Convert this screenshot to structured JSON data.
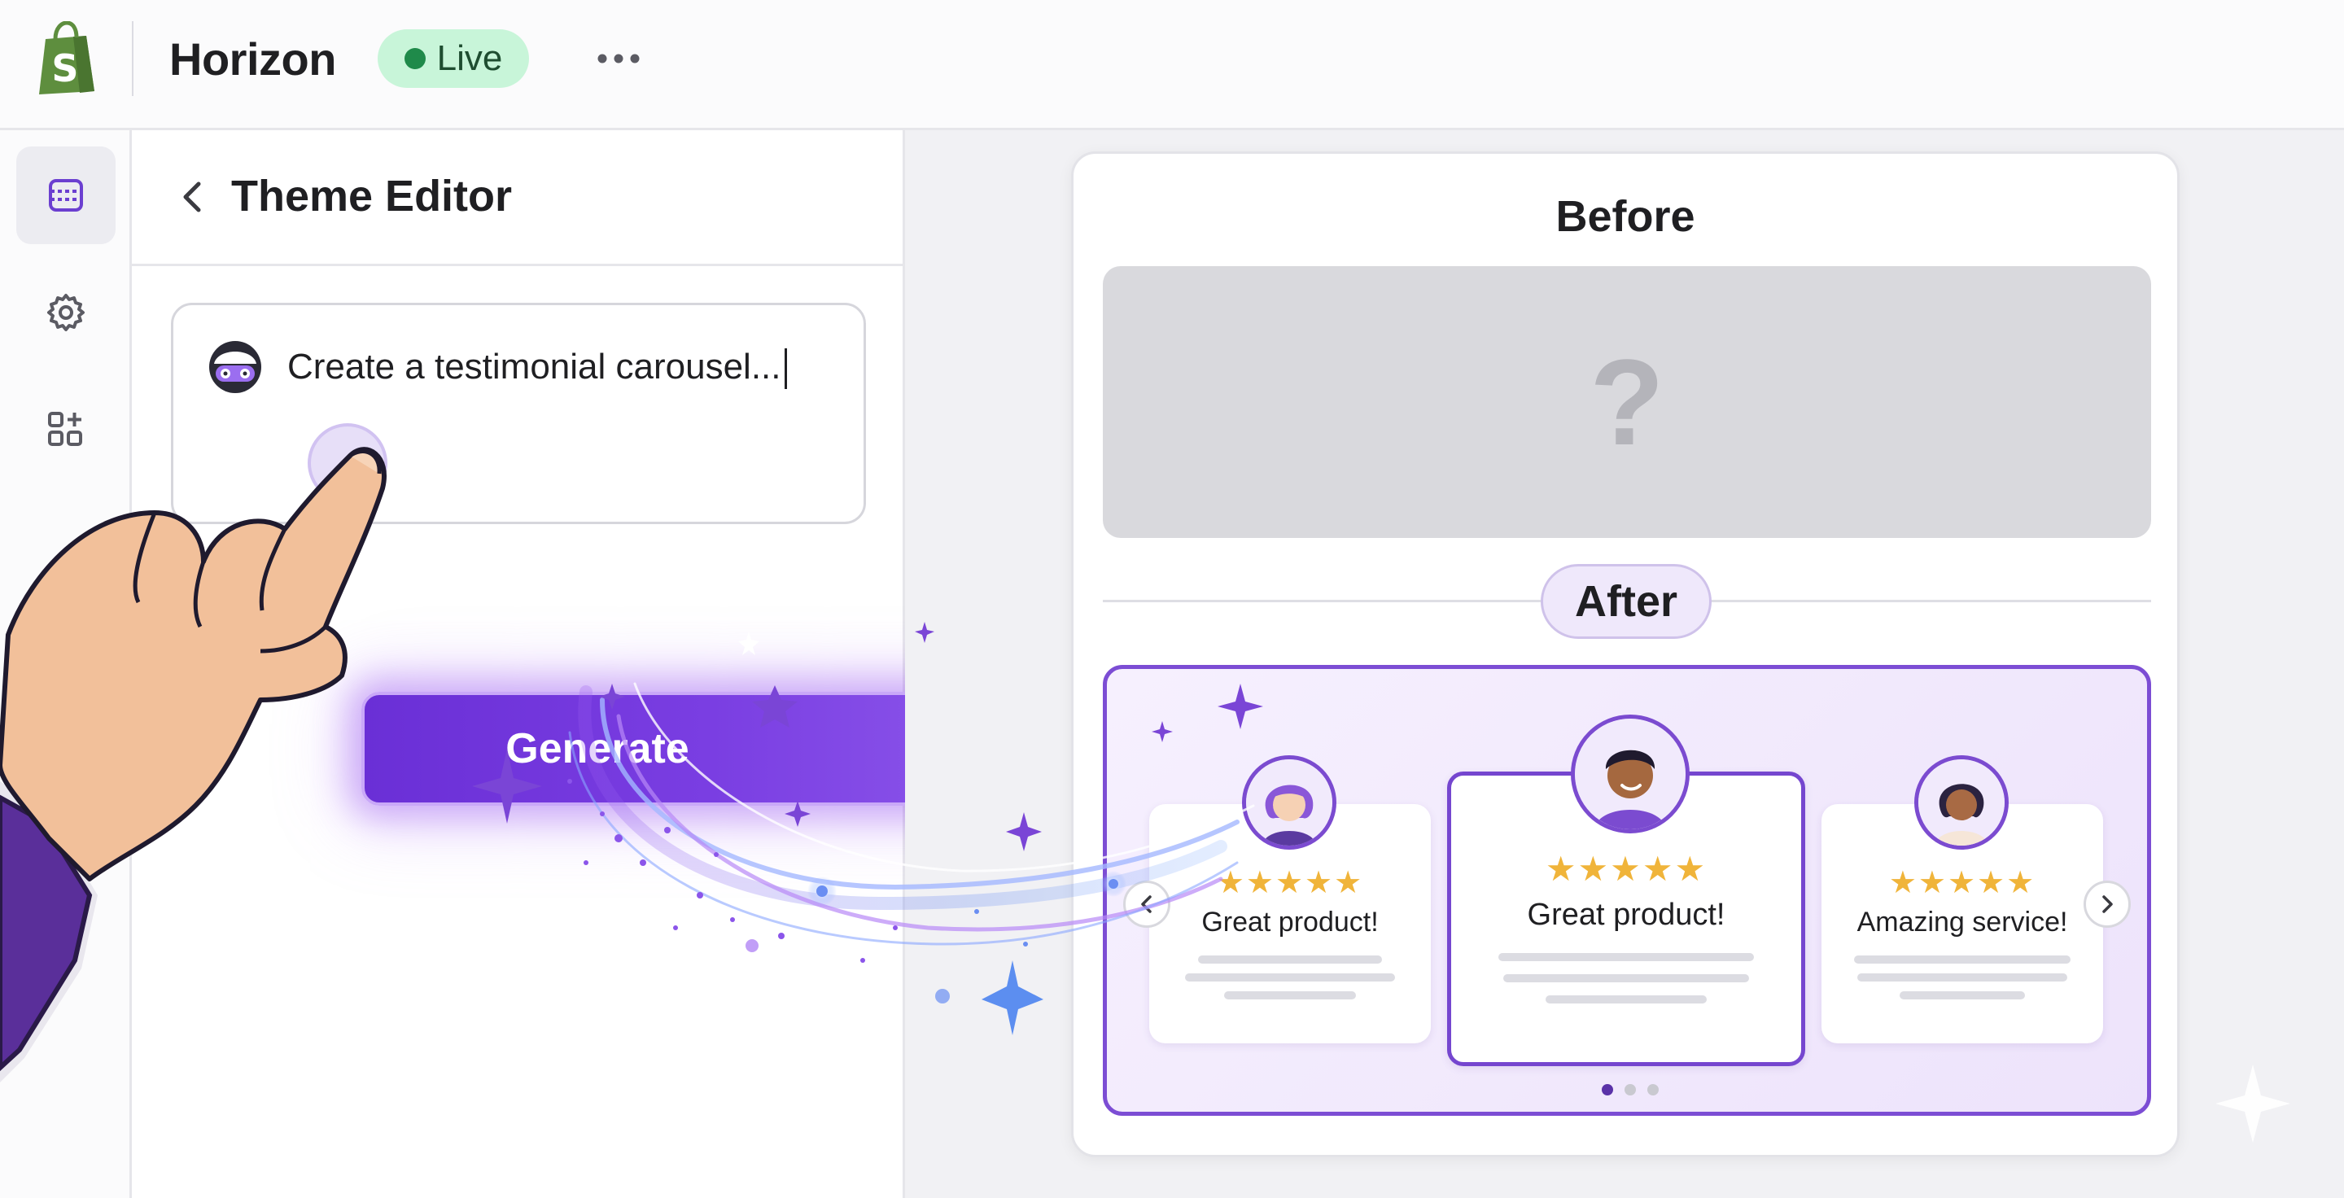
{
  "topbar": {
    "store_name": "Horizon",
    "status_label": "Live",
    "icons": [
      "shopify-logo-icon",
      "more-icon"
    ]
  },
  "rail": {
    "icons": [
      "sections-icon",
      "settings-icon",
      "apps-icon"
    ]
  },
  "editor": {
    "title": "Theme Editor",
    "prompt_value": "Create a testimonial carousel...",
    "generate_label": "Generate"
  },
  "preview": {
    "before_label": "Before",
    "placeholder_mark": "?",
    "after_label": "After",
    "testimonials": [
      {
        "stars": "★★★★★",
        "rating": 5,
        "quote": "Great product!"
      },
      {
        "stars": "★★★★★",
        "rating": 4.5,
        "quote": "Great product!"
      },
      {
        "stars": "★★★★★",
        "rating": 4.5,
        "quote": "Amazing service!"
      }
    ],
    "pagination": {
      "pages": 3,
      "current": 1
    }
  },
  "colors": {
    "brand_purple": "#7546cf",
    "live_bg": "#c8f5d9",
    "live_dot": "#1f8a4a",
    "star": "#f0b43a"
  }
}
